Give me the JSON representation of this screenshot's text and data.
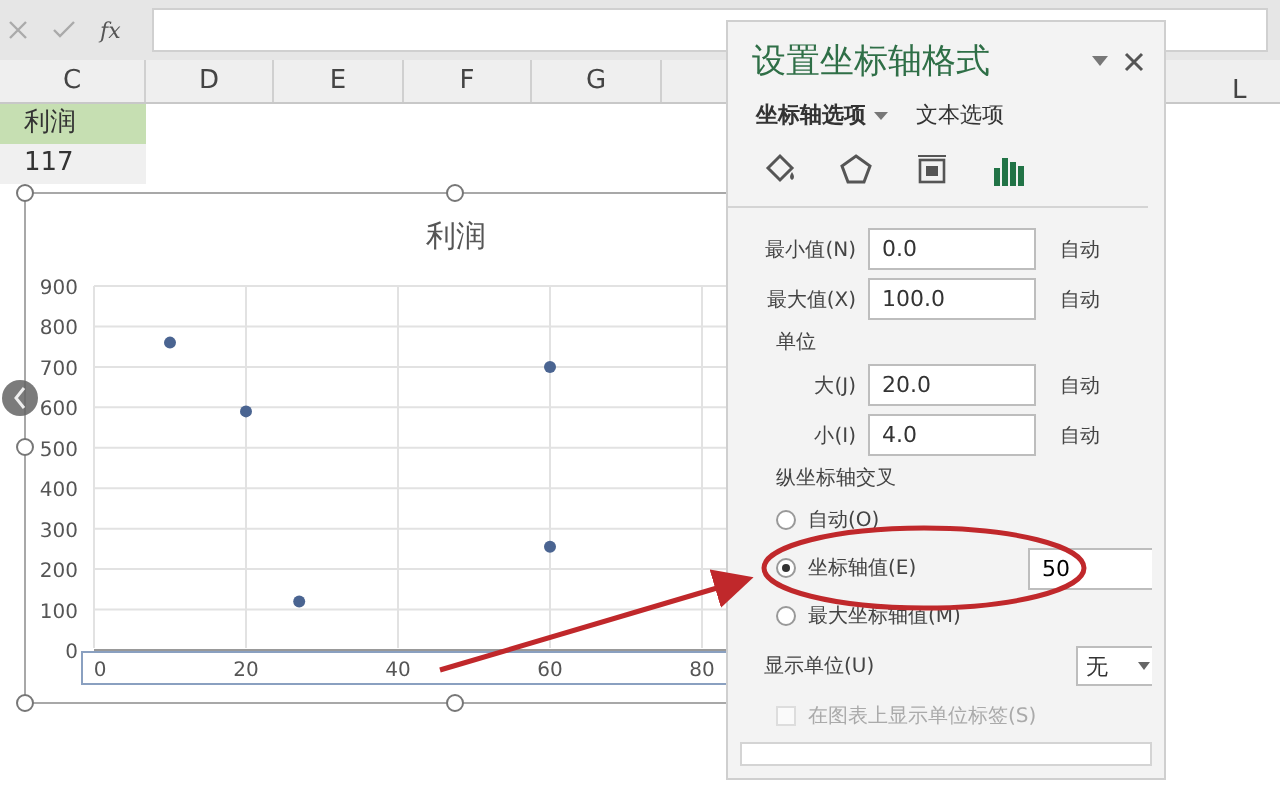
{
  "formula_bar": {
    "function_label": "fx"
  },
  "columns": [
    "C",
    "D",
    "E",
    "F",
    "G"
  ],
  "cells": [
    {
      "text": "利润",
      "highlighted": true
    },
    {
      "text": "117",
      "highlighted": false
    }
  ],
  "hidden_column": "L",
  "chart": {
    "title": "利润",
    "chart_data": {
      "type": "scatter",
      "x": [
        10,
        20,
        27,
        60,
        60
      ],
      "series": [
        {
          "color": "#4a6491",
          "values": [
            760,
            590,
            120,
            700,
            255
          ]
        }
      ],
      "grid": true,
      "xlim": [
        0,
        84
      ],
      "ylim": [
        0,
        900
      ],
      "xticks": [
        0,
        20,
        40,
        60,
        80
      ],
      "yticks": [
        0,
        100,
        200,
        300,
        400,
        500,
        600,
        700,
        800,
        900
      ]
    }
  },
  "panel": {
    "title": "设置坐标轴格式",
    "tabs": [
      {
        "label": "坐标轴选项",
        "selected": true
      },
      {
        "label": "文本选项",
        "selected": false
      }
    ],
    "icon_tabs": [
      {
        "kind": "fill",
        "selected": false
      },
      {
        "kind": "effects",
        "selected": false
      },
      {
        "kind": "size",
        "selected": false
      },
      {
        "kind": "axis",
        "selected": true
      }
    ],
    "bounds": [
      {
        "label": "最小值(N)",
        "value": "0.0",
        "reset": "自动"
      },
      {
        "label": "最大值(X)",
        "value": "100.0",
        "reset": "自动"
      }
    ],
    "units_heading": "单位",
    "units": [
      {
        "label": "大(J)",
        "value": "20.0",
        "reset": "自动"
      },
      {
        "label": "小(I)",
        "value": "4.0",
        "reset": "自动"
      }
    ],
    "cross_heading": "纵坐标轴交叉",
    "cross_options": [
      {
        "label": "自动(O)",
        "selected": false
      },
      {
        "label": "坐标轴值(E)",
        "selected": true,
        "value": "50"
      },
      {
        "label": "最大坐标轴值(M)",
        "selected": false
      }
    ],
    "display_units": {
      "label": "显示单位(U)",
      "value": "无"
    },
    "show_label": {
      "label": "在图表上显示单位标签(S)",
      "checked": false,
      "disabled": true
    }
  }
}
